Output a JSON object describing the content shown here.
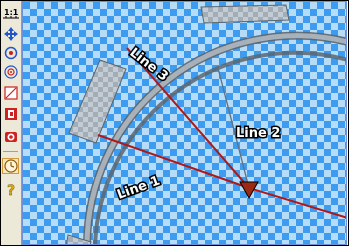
{
  "canvas": {
    "checker_color_light": "#b7dcf7",
    "checker_color_dark": "#3d9cf0",
    "ring_fill": "#b0b8c0",
    "ring_stroke": "#5a6670"
  },
  "toolbar": {
    "tools": [
      {
        "icon": "zoom-to-fit-icon",
        "label": "1:1"
      },
      {
        "icon": "pan-icon"
      },
      {
        "icon": "rotate-icon"
      },
      {
        "icon": "target-icon"
      },
      {
        "icon": "measure-icon"
      },
      {
        "icon": "calibrate-icon"
      },
      {
        "icon": "camera-icon"
      },
      {
        "icon": "timer-icon",
        "active": true
      },
      {
        "icon": "help-icon",
        "label": "?"
      }
    ]
  },
  "lines": [
    {
      "name": "Line 1",
      "color": "#b01818"
    },
    {
      "name": "Line 2",
      "color": "#607080"
    },
    {
      "name": "Line 3",
      "color": "#b01818"
    }
  ]
}
